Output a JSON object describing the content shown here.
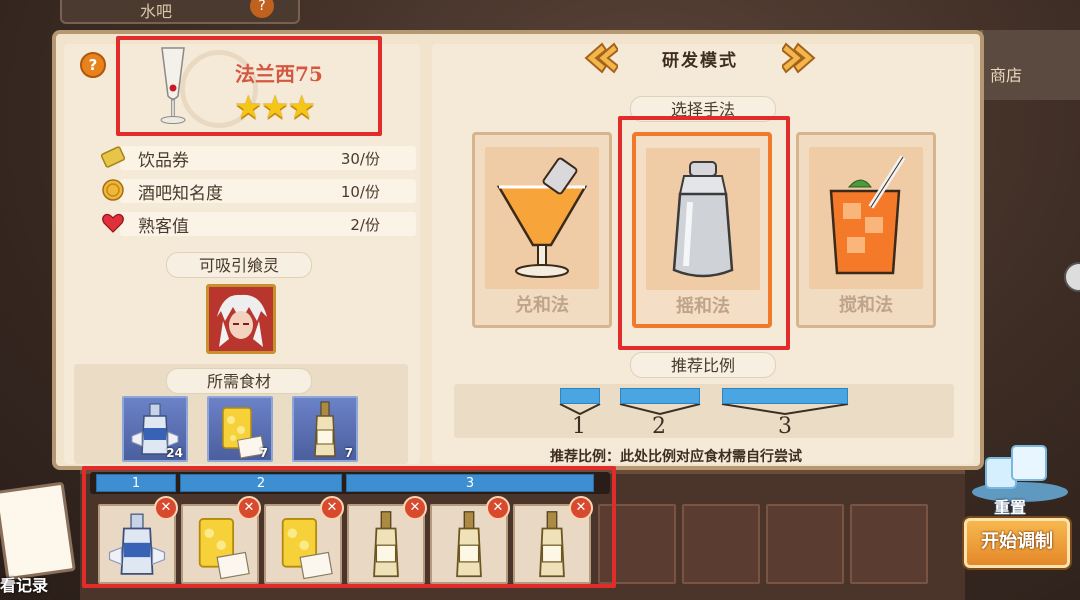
{
  "top": {
    "tab_label": "水吧",
    "help": "?",
    "shop_label": "商店"
  },
  "drink": {
    "help": "?",
    "name": "法兰西75",
    "stars": 3
  },
  "stats": [
    {
      "label": "饮品券",
      "value": "30/份",
      "icon": "ticket-icon"
    },
    {
      "label": "酒吧知名度",
      "value": "10/份",
      "icon": "coin-icon"
    },
    {
      "label": "熟客值",
      "value": "2/份",
      "icon": "heart-icon"
    }
  ],
  "spirit_section": {
    "title": "可吸引飨灵"
  },
  "ingredients_section": {
    "title": "所需食材",
    "items": [
      {
        "name": "vodka-bottle",
        "count": "24"
      },
      {
        "name": "lemon-juice",
        "count": "7"
      },
      {
        "name": "champagne-bottle",
        "count": "7"
      }
    ]
  },
  "mode": {
    "title": "研发模式"
  },
  "method_section": {
    "title": "选择手法",
    "methods": [
      {
        "label": "兑和法"
      },
      {
        "label": "摇和法",
        "selected": true
      },
      {
        "label": "搅和法"
      }
    ]
  },
  "recommend": {
    "title": "推荐比例",
    "ratios": [
      "1",
      "2",
      "3"
    ],
    "note": "推荐比例：此处比例对应食材需自行尝试"
  },
  "shelf": {
    "ratio_strip": [
      "1",
      "2",
      "3"
    ],
    "slots": [
      {
        "item": "vodka-bottle",
        "filled": true
      },
      {
        "item": "lemon-juice",
        "filled": true
      },
      {
        "item": "lemon-juice",
        "filled": true
      },
      {
        "item": "champagne-bottle",
        "filled": true
      },
      {
        "item": "champagne-bottle",
        "filled": true
      },
      {
        "item": "champagne-bottle",
        "filled": true
      },
      {
        "item": "",
        "filled": false
      },
      {
        "item": "",
        "filled": false
      },
      {
        "item": "",
        "filled": false
      },
      {
        "item": "",
        "filled": false
      }
    ],
    "remove_symbol": "✕"
  },
  "controls": {
    "record_label": "看记录",
    "reset_label": "重置",
    "start_label": "开始调制"
  }
}
